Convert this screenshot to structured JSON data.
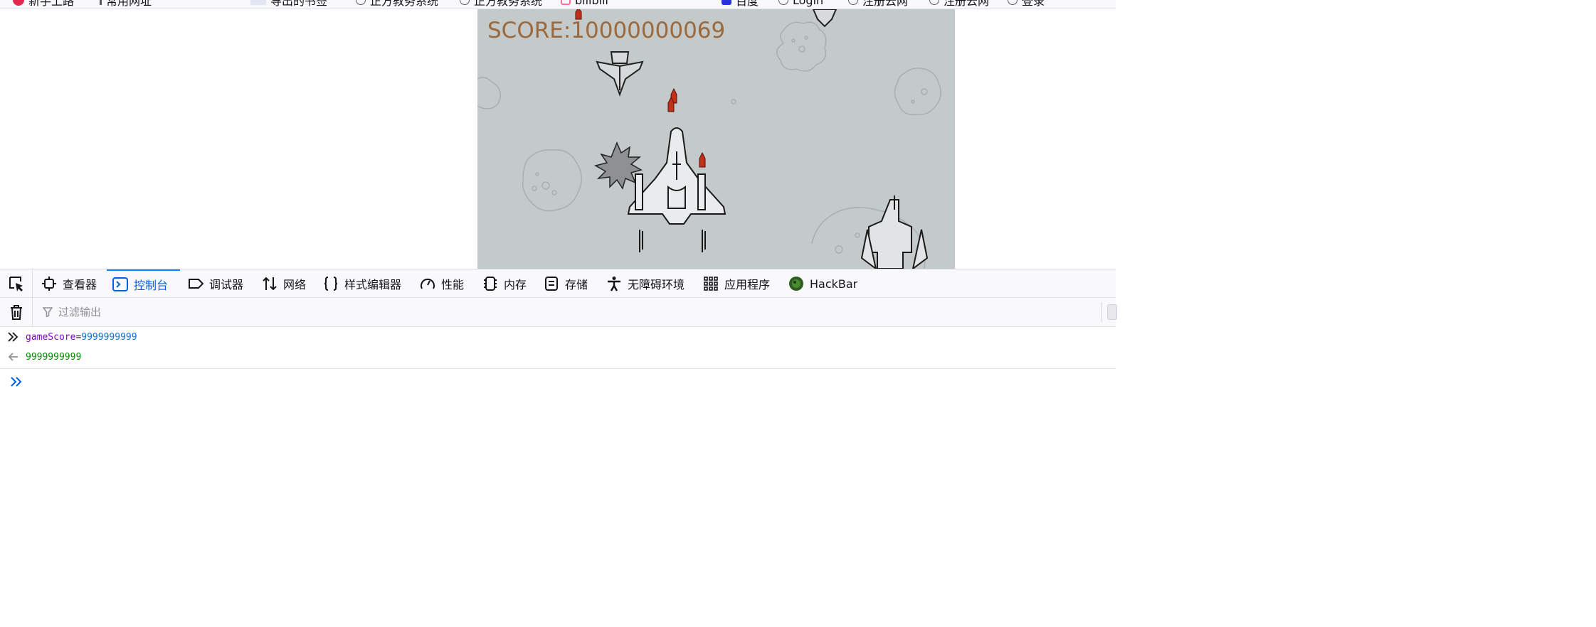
{
  "bookmarks": [
    {
      "label": "新手上路",
      "icon": "firefox-icon"
    },
    {
      "label": "常用网址",
      "icon": "folder-icon"
    },
    {
      "label": "导出的书签",
      "icon": "bookmark-icon"
    },
    {
      "label": "正方教务系统",
      "icon": "globe-icon"
    },
    {
      "label": "正方教务系统",
      "icon": "globe-icon"
    },
    {
      "label": "bilibili",
      "icon": "bilibili-icon"
    },
    {
      "label": "百度",
      "icon": "baidu-icon"
    },
    {
      "label": "Login",
      "icon": "globe-icon"
    },
    {
      "label": "注册云网",
      "icon": "globe-icon"
    },
    {
      "label": "注册云网",
      "icon": "globe-icon"
    },
    {
      "label": "登录",
      "icon": "globe-icon"
    }
  ],
  "game": {
    "score_text": "SCORE:10000000069",
    "score_color": "#9a6a3e",
    "background_color": "#c4c9c9"
  },
  "devtools": {
    "tabs": [
      {
        "label": "查看器",
        "icon": "inspector-icon"
      },
      {
        "label": "控制台",
        "icon": "console-icon",
        "selected": true
      },
      {
        "label": "调试器",
        "icon": "debugger-icon"
      },
      {
        "label": "网络",
        "icon": "network-icon"
      },
      {
        "label": "样式编辑器",
        "icon": "style-editor-icon"
      },
      {
        "label": "性能",
        "icon": "performance-icon"
      },
      {
        "label": "内存",
        "icon": "memory-icon"
      },
      {
        "label": "存储",
        "icon": "storage-icon"
      },
      {
        "label": "无障碍环境",
        "icon": "accessibility-icon"
      },
      {
        "label": "应用程序",
        "icon": "application-icon"
      },
      {
        "label": "HackBar",
        "icon": "hackbar-icon"
      }
    ],
    "accent_color": "#0060df"
  },
  "console": {
    "filter_placeholder": "过滤输出",
    "filter_value": "",
    "input": {
      "variable": "gameScore",
      "operator": "=",
      "value": "9999999999"
    },
    "result": "9999999999",
    "prompt_value": ""
  }
}
